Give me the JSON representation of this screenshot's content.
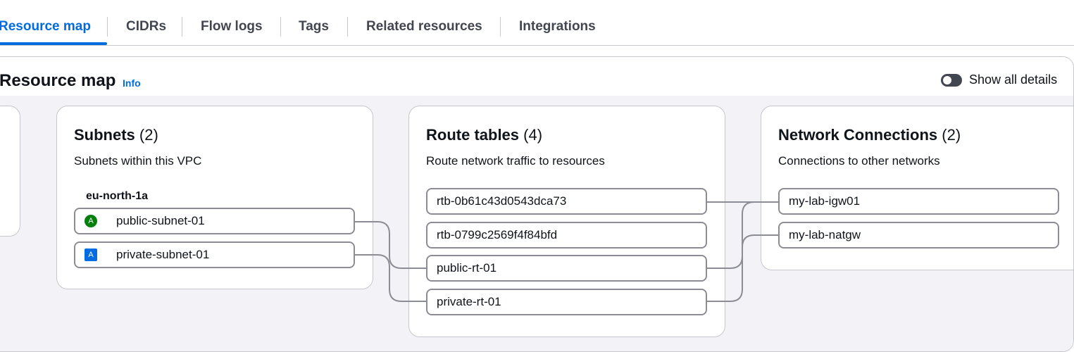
{
  "tabs": [
    {
      "label": "Resource map",
      "active": true
    },
    {
      "label": "CIDRs"
    },
    {
      "label": "Flow logs"
    },
    {
      "label": "Tags"
    },
    {
      "label": "Related resources"
    },
    {
      "label": "Integrations"
    }
  ],
  "panel": {
    "title": "Resource map",
    "info_label": "Info",
    "toggle_label": "Show all details",
    "toggle_on": false
  },
  "subnets": {
    "title": "Subnets",
    "count": "(2)",
    "description": "Subnets within this VPC",
    "az": "eu-north-1a",
    "items": [
      {
        "name": "public-subnet-01",
        "badge": "A",
        "badge_color": "#037f0c"
      },
      {
        "name": "private-subnet-01",
        "badge": "A",
        "badge_color": "#006ce0"
      }
    ]
  },
  "route_tables": {
    "title": "Route tables",
    "count": "(4)",
    "description": "Route network traffic to resources",
    "items": [
      {
        "name": "rtb-0b61c43d0543dca73"
      },
      {
        "name": "rtb-0799c2569f4f84bfd"
      },
      {
        "name": "public-rt-01"
      },
      {
        "name": "private-rt-01"
      }
    ]
  },
  "network_connections": {
    "title": "Network Connections",
    "count": "(2)",
    "description": "Connections to other networks",
    "items": [
      {
        "name": "my-lab-igw01"
      },
      {
        "name": "my-lab-natgw"
      }
    ]
  },
  "colors": {
    "accent": "#006ce0",
    "connector": "#8c8c94",
    "map_background": "#f3f3f7"
  }
}
